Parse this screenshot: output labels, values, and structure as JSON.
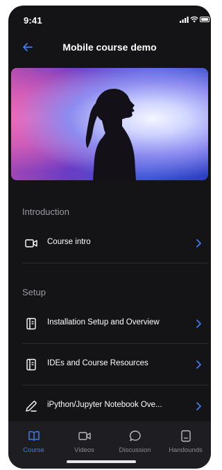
{
  "status_bar": {
    "time": "9:41"
  },
  "navbar": {
    "title": "Mobile course demo"
  },
  "sections": [
    {
      "title": "Introduction",
      "items": [
        {
          "label": "Course intro",
          "icon": "video-icon"
        }
      ]
    },
    {
      "title": "Setup",
      "items": [
        {
          "label": "Installation Setup and Overview",
          "icon": "document-icon"
        },
        {
          "label": "IDEs and Course Resources",
          "icon": "document-icon"
        },
        {
          "label": "iPython/Jupyter Notebook Ove...",
          "icon": "pen-icon"
        }
      ]
    }
  ],
  "tabs": [
    {
      "label": "Course",
      "icon": "book-icon",
      "active": true
    },
    {
      "label": "Videos",
      "icon": "video-icon",
      "active": false
    },
    {
      "label": "Discussion",
      "icon": "chat-bubble-icon",
      "active": false
    },
    {
      "label": "Handounds",
      "icon": "file-icon",
      "active": false
    }
  ],
  "colors": {
    "background": "#141416",
    "accent": "#3d7bf0",
    "tab_bar": "#1e1e22",
    "text_primary": "#ffffff",
    "text_secondary": "#9a9aa0"
  }
}
